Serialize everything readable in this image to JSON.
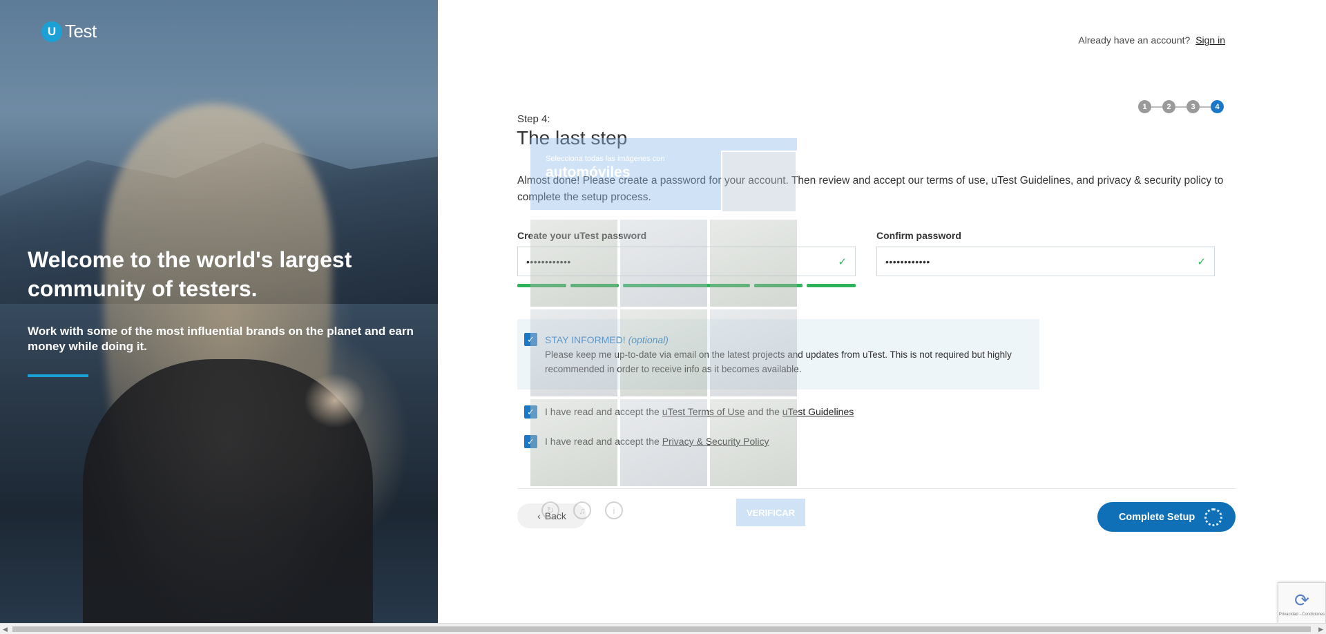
{
  "brand": {
    "logo_letter": "U",
    "logo_text": "Test",
    "accent": "#1ba1d6",
    "primary_button": "#0f70b7"
  },
  "hero": {
    "title": "Welcome to the world's largest community of testers.",
    "subtitle": "Work with some of the most influential brands on the planet and earn money while doing it."
  },
  "header": {
    "account_prompt": "Already have an account?",
    "signin_link": "Sign in"
  },
  "stepper": {
    "steps": [
      "1",
      "2",
      "3",
      "4"
    ],
    "active_step": "4"
  },
  "form": {
    "step_label": "Step 4:",
    "title": "The last step",
    "intro": "Almost done! Please create a password for your account. Then review and accept our terms of use, uTest Guidelines, and privacy & security policy to complete the setup process.",
    "password_label": "Create your uTest password",
    "password_value": "••••••••••••",
    "confirm_label": "Confirm password",
    "confirm_value": "••••••••••••",
    "stay_informed_title": "STAY INFORMED!",
    "stay_informed_optional": "(optional)",
    "stay_informed_text": "Please keep me up-to-date via email on the latest projects and updates from uTest. This is not required but highly recommended in order to receive info as it becomes available.",
    "terms_prefix": "I have read and accept the",
    "terms_link": "uTest Terms of Use",
    "terms_mid": "and the",
    "guidelines_link": "uTest Guidelines",
    "privacy_prefix": "I have read and accept the",
    "privacy_link": "Privacy & Security Policy",
    "back_label": "Back",
    "complete_label": "Complete Setup"
  },
  "captcha": {
    "instruction": "Selecciona todas las imágenes con",
    "target": "automóviles",
    "verify_label": "VERIFICAR"
  },
  "recaptcha_badge": {
    "text": "Privacidad - Condiciones"
  }
}
